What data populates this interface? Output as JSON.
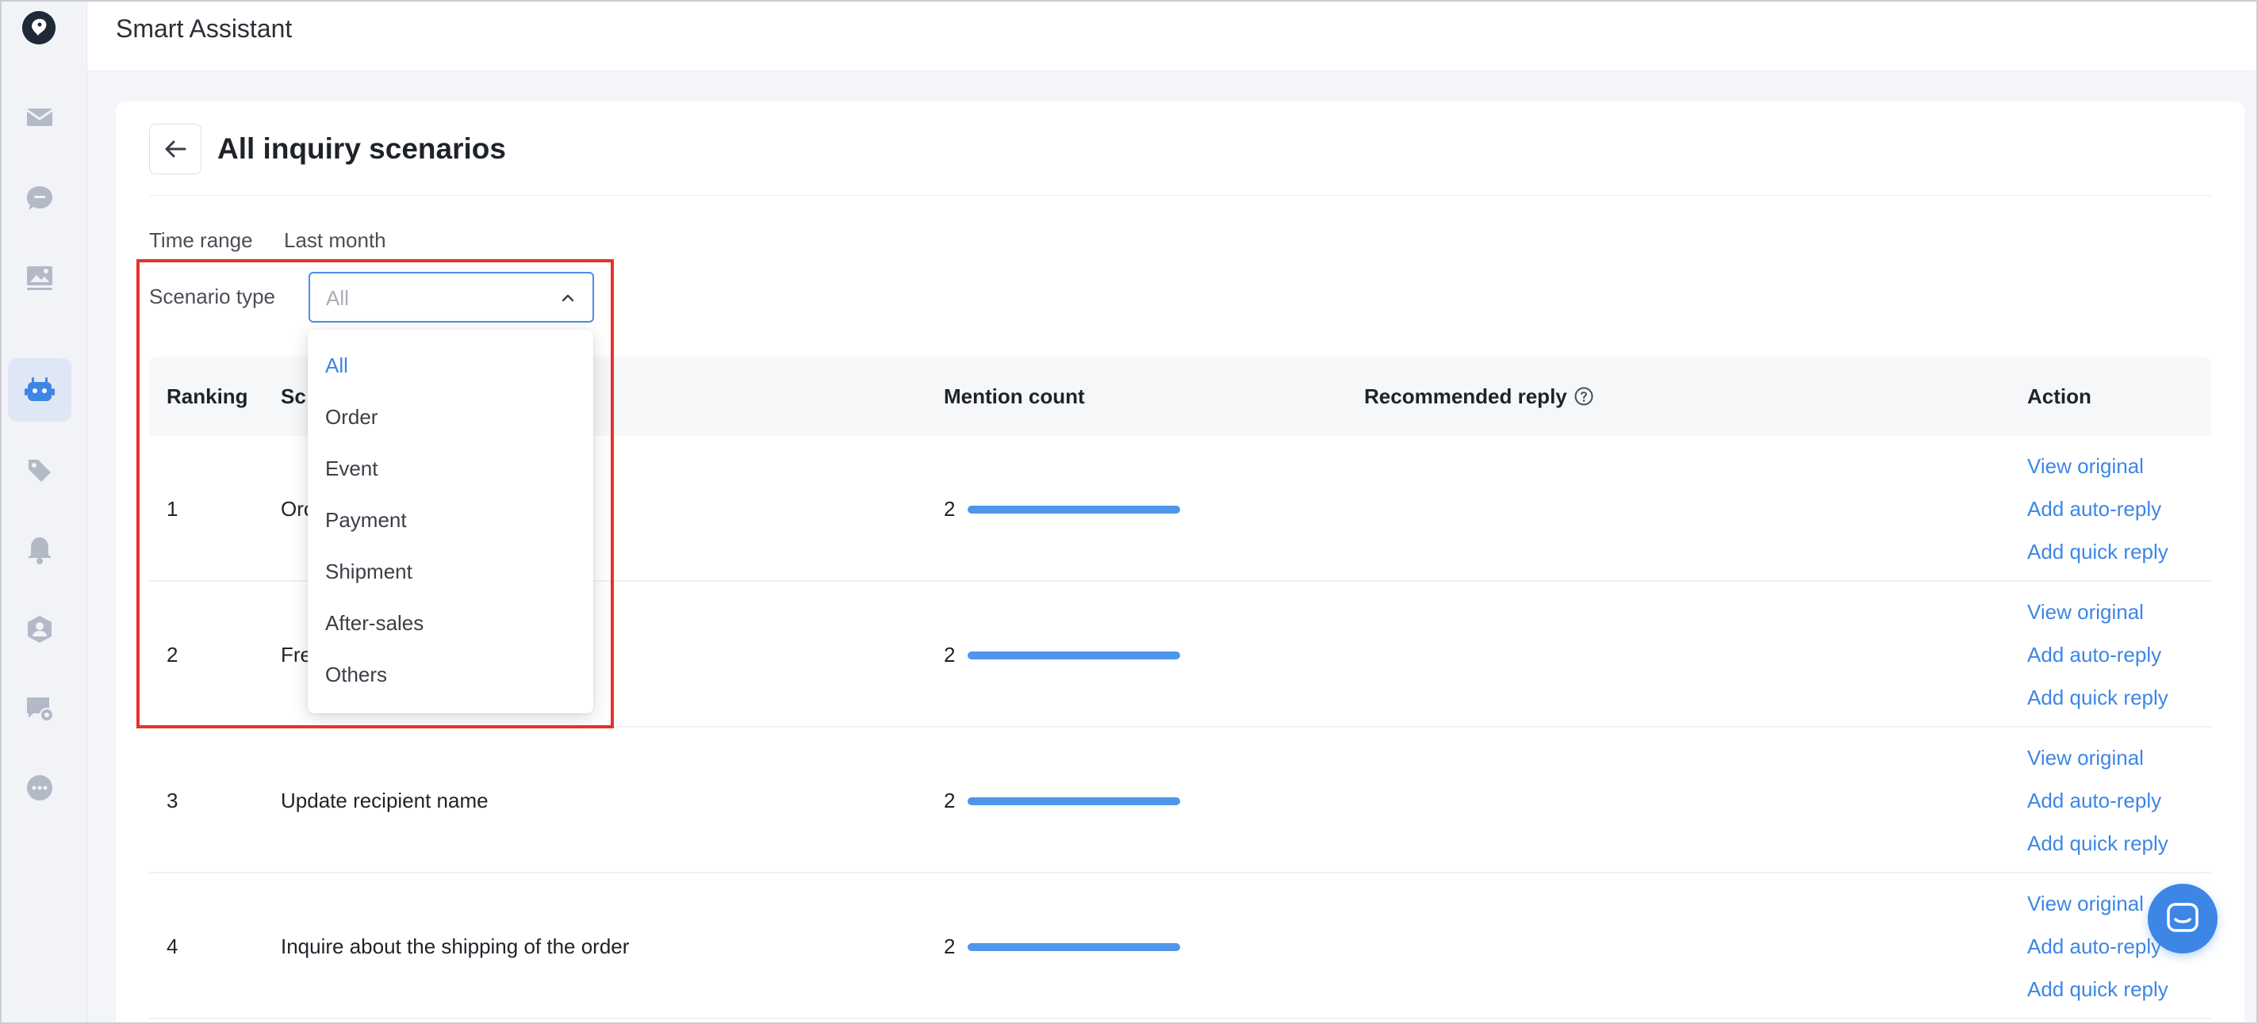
{
  "app": {
    "title": "Smart Assistant"
  },
  "sidebar": {
    "items": [
      {
        "icon": "mail-icon"
      },
      {
        "icon": "chat-bubble-icon"
      },
      {
        "icon": "image-icon"
      },
      {
        "icon": "robot-icon",
        "active": true
      },
      {
        "icon": "tag-icon"
      },
      {
        "icon": "bell-icon"
      },
      {
        "icon": "user-shield-icon"
      },
      {
        "icon": "chat-settings-icon"
      },
      {
        "icon": "more-icon"
      }
    ]
  },
  "page": {
    "title": "All inquiry scenarios"
  },
  "filters": {
    "time_range_label": "Time range",
    "time_range_value": "Last month",
    "scenario_type_label": "Scenario type",
    "scenario_type_value": "All"
  },
  "dropdown": {
    "options": [
      "All",
      "Order",
      "Event",
      "Payment",
      "Shipment",
      "After-sales",
      "Others"
    ],
    "selected": "All"
  },
  "table": {
    "headers": {
      "ranking": "Ranking",
      "scenario": "Sc",
      "mention_count": "Mention count",
      "recommended_reply": "Recommended reply",
      "action": "Action"
    },
    "rows": [
      {
        "rank": "1",
        "scenario": "Orc",
        "count": "2",
        "count_fill": 1.0
      },
      {
        "rank": "2",
        "scenario": "Fre",
        "count": "2",
        "count_fill": 1.0
      },
      {
        "rank": "3",
        "scenario": "Update recipient name",
        "count": "2",
        "count_fill": 1.0
      },
      {
        "rank": "4",
        "scenario": "Inquire about the shipping of the order",
        "count": "2",
        "count_fill": 1.0
      }
    ],
    "actions": {
      "view_original": "View original",
      "add_auto_reply": "Add auto-reply",
      "add_quick_reply": "Add quick reply"
    }
  },
  "colors": {
    "accent": "#3d86e6",
    "highlight": "#e5332a",
    "bar": "#4e96ec"
  }
}
